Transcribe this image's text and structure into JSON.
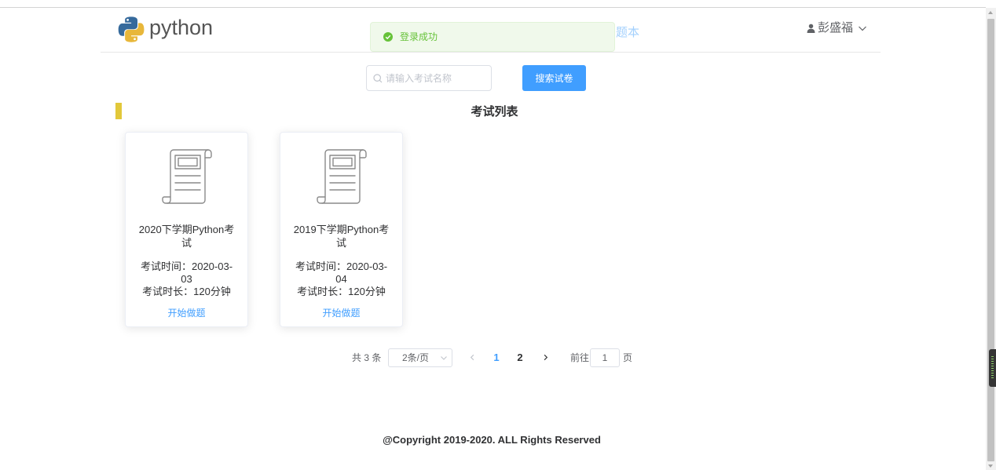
{
  "header": {
    "logo_text": "python",
    "nav_item": "题本",
    "user_name": "彭盛福"
  },
  "toast": {
    "message": "登录成功"
  },
  "search": {
    "placeholder": "请输入考试名称",
    "value": "",
    "button_label": "搜索试卷"
  },
  "section": {
    "title": "考试列表"
  },
  "exams": [
    {
      "title": "2020下学期Python考试",
      "time_label": "考试时间：",
      "date": "2020-03-03",
      "duration_label": "考试时长：",
      "duration": "120分钟",
      "action_label": "开始做题"
    },
    {
      "title": "2019下学期Python考试",
      "time_label": "考试时间：",
      "date": "2020-03-04",
      "duration_label": "考试时长：",
      "duration": "120分钟",
      "action_label": "开始做题"
    }
  ],
  "pagination": {
    "total_text": "共 3 条",
    "page_size": "2条/页",
    "pages": [
      "1",
      "2"
    ],
    "current_page": 1,
    "goto_label": "前往",
    "goto_value": "1",
    "goto_suffix": "页"
  },
  "footer": {
    "copyright": "@Copyright 2019-2020. ALL Rights Reserved"
  },
  "colors": {
    "accent": "#409eff",
    "success": "#67c23a",
    "success_bg": "#f0f9eb",
    "section_marker": "#e2c83a",
    "logo_blue": "#366a9c",
    "logo_yellow": "#e8b73a"
  },
  "icons": {
    "logo": "python-logo-icon",
    "toast": "success-check-icon",
    "user": "user-icon",
    "user_menu": "chevron-down-icon",
    "search": "search-icon",
    "exam_card": "document-scroll-icon",
    "page_size": "chevron-down-icon",
    "page_prev": "chevron-left-icon",
    "page_next": "chevron-right-icon"
  }
}
